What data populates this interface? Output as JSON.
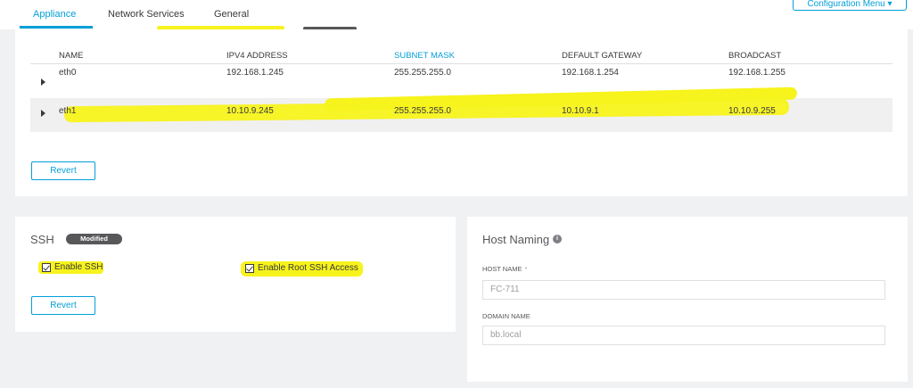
{
  "tabs": [
    {
      "label": "Appliance",
      "active": true
    },
    {
      "label": "Network Services",
      "active": false
    },
    {
      "label": "General",
      "active": false
    }
  ],
  "config_menu": {
    "label": "Configuration Menu",
    "icon": "chevron-down-icon"
  },
  "interfaces": {
    "columns": [
      "NAME",
      "IPV4 ADDRESS",
      "SUBNET MASK",
      "DEFAULT GATEWAY",
      "BROADCAST"
    ],
    "sorted_column": "SUBNET MASK",
    "rows": [
      {
        "name": "eth0",
        "ipv4": "192.168.1.245",
        "subnet": "255.255.255.0",
        "gateway": "192.168.1.254",
        "broadcast": "192.168.1.255",
        "selected": false
      },
      {
        "name": "eth1",
        "ipv4": "10.10.9.245",
        "subnet": "255.255.255.0",
        "gateway": "10.10.9.1",
        "broadcast": "10.10.9.255",
        "selected": true
      }
    ],
    "revert_label": "Revert"
  },
  "ssh": {
    "title": "SSH",
    "badge": "Modified",
    "enable_ssh": {
      "label": "Enable SSH",
      "checked": true
    },
    "enable_root": {
      "label": "Enable Root SSH Access",
      "checked": true
    },
    "revert_label": "Revert"
  },
  "host_naming": {
    "title": "Host Naming",
    "host_name_label": "HOST NAME",
    "host_name_required": "*",
    "host_name_value": "FC-711",
    "domain_name_label": "DOMAIN NAME",
    "domain_name_value": "bb.local"
  },
  "colors": {
    "accent": "#049fd9",
    "highlight": "#f7f31c",
    "badge": "#58585b"
  }
}
